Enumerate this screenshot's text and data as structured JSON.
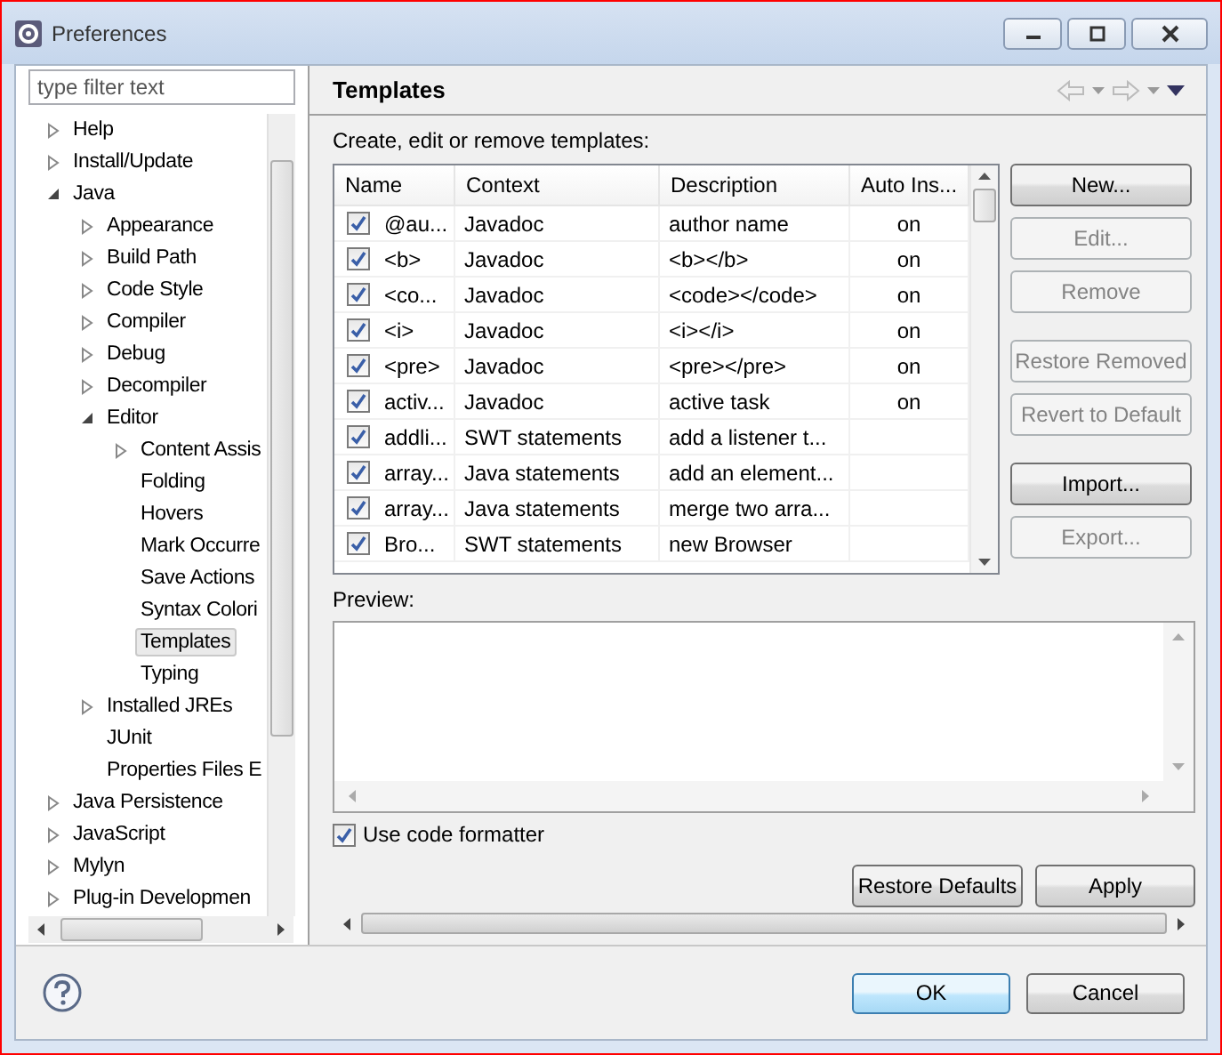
{
  "window": {
    "title": "Preferences"
  },
  "filter": {
    "placeholder": "type filter text"
  },
  "tree": [
    {
      "label": "Help",
      "kind": "collapsed",
      "selected": false
    },
    {
      "label": "Install/Update",
      "kind": "collapsed",
      "selected": false
    },
    {
      "label": "Java",
      "kind": "expanded",
      "selected": false,
      "children": [
        {
          "label": "Appearance",
          "kind": "collapsed",
          "selected": false
        },
        {
          "label": "Build Path",
          "kind": "collapsed",
          "selected": false
        },
        {
          "label": "Code Style",
          "kind": "collapsed",
          "selected": false
        },
        {
          "label": "Compiler",
          "kind": "collapsed",
          "selected": false
        },
        {
          "label": "Debug",
          "kind": "collapsed",
          "selected": false
        },
        {
          "label": "Decompiler",
          "kind": "collapsed",
          "selected": false
        },
        {
          "label": "Editor",
          "kind": "expanded",
          "selected": false,
          "children": [
            {
              "label": "Content Assis",
              "kind": "collapsed",
              "selected": false
            },
            {
              "label": "Folding",
              "kind": "leaf",
              "selected": false
            },
            {
              "label": "Hovers",
              "kind": "leaf",
              "selected": false
            },
            {
              "label": "Mark Occurre",
              "kind": "leaf",
              "selected": false
            },
            {
              "label": "Save Actions",
              "kind": "leaf",
              "selected": false
            },
            {
              "label": "Syntax Colori",
              "kind": "leaf",
              "selected": false
            },
            {
              "label": "Templates",
              "kind": "leaf",
              "selected": true
            },
            {
              "label": "Typing",
              "kind": "leaf",
              "selected": false
            }
          ]
        },
        {
          "label": "Installed JREs",
          "kind": "collapsed",
          "selected": false
        },
        {
          "label": "JUnit",
          "kind": "leaf",
          "selected": false
        },
        {
          "label": "Properties Files E",
          "kind": "leaf",
          "selected": false
        }
      ]
    },
    {
      "label": "Java Persistence",
      "kind": "collapsed",
      "selected": false
    },
    {
      "label": "JavaScript",
      "kind": "collapsed",
      "selected": false
    },
    {
      "label": "Mylyn",
      "kind": "collapsed",
      "selected": false
    },
    {
      "label": "Plug-in Developmen",
      "kind": "collapsed",
      "selected": false
    }
  ],
  "page": {
    "title": "Templates",
    "description": "Create, edit or remove templates:"
  },
  "table": {
    "columns": [
      "Name",
      "Context",
      "Description",
      "Auto Ins..."
    ],
    "rows": [
      {
        "checked": true,
        "name": "@au...",
        "context": "Javadoc",
        "description": "author name",
        "auto_insert": "on"
      },
      {
        "checked": true,
        "name": "<b>",
        "context": "Javadoc",
        "description": "<b></b>",
        "auto_insert": "on"
      },
      {
        "checked": true,
        "name": "<co...",
        "context": "Javadoc",
        "description": "<code></code>",
        "auto_insert": "on"
      },
      {
        "checked": true,
        "name": "<i>",
        "context": "Javadoc",
        "description": "<i></i>",
        "auto_insert": "on"
      },
      {
        "checked": true,
        "name": "<pre>",
        "context": "Javadoc",
        "description": "<pre></pre>",
        "auto_insert": "on"
      },
      {
        "checked": true,
        "name": "activ...",
        "context": "Javadoc",
        "description": "active task",
        "auto_insert": "on"
      },
      {
        "checked": true,
        "name": "addli...",
        "context": "SWT statements",
        "description": "add a listener t..."
      },
      {
        "checked": true,
        "name": "array...",
        "context": "Java statements",
        "description": "add an element..."
      },
      {
        "checked": true,
        "name": "array...",
        "context": "Java statements",
        "description": "merge two arra..."
      },
      {
        "checked": true,
        "name": "Bro...",
        "context": "SWT statements",
        "description": "new Browser"
      }
    ]
  },
  "side_buttons": [
    {
      "label": "New...",
      "disabled": false
    },
    {
      "label": "Edit...",
      "disabled": true
    },
    {
      "label": "Remove",
      "disabled": true
    },
    {
      "label": "Restore Removed",
      "disabled": true
    },
    {
      "label": "Revert to Default",
      "disabled": true
    },
    {
      "label": "Import...",
      "disabled": false
    },
    {
      "label": "Export...",
      "disabled": true
    }
  ],
  "preview": {
    "label": "Preview:"
  },
  "use_code_formatter": {
    "label": "Use code formatter",
    "checked": true
  },
  "page_buttons": [
    "Restore Defaults",
    "Apply"
  ],
  "dialog_buttons": [
    {
      "label": "OK",
      "default": true
    },
    {
      "label": "Cancel",
      "default": false
    }
  ]
}
